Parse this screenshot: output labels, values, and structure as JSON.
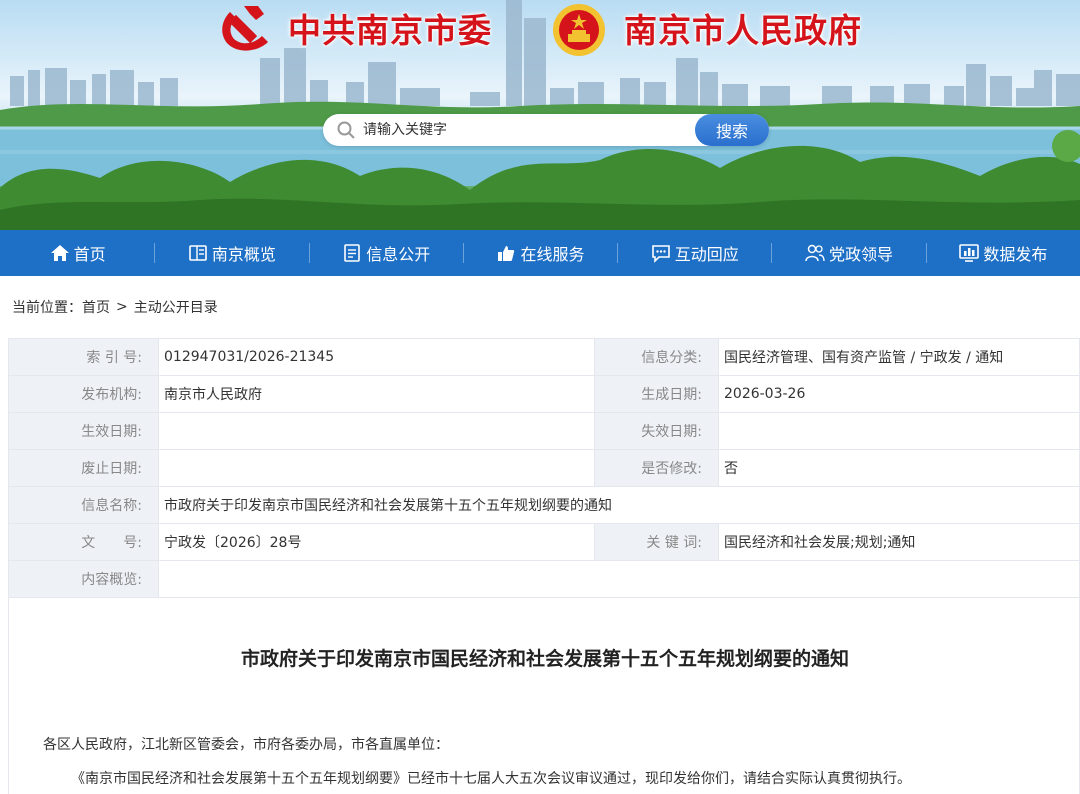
{
  "header": {
    "brand_left": "中共南京市委",
    "brand_right": "南京市人民政府",
    "party_emblem_icon": "party-emblem-icon",
    "national_emblem_icon": "national-emblem-icon",
    "accent_color": "#d4141a"
  },
  "search": {
    "placeholder": "请输入关键字",
    "button_label": "搜索"
  },
  "nav": {
    "items": [
      {
        "label": "首页",
        "icon": "home-icon"
      },
      {
        "label": "南京概览",
        "icon": "overview-icon"
      },
      {
        "label": "信息公开",
        "icon": "document-icon"
      },
      {
        "label": "在线服务",
        "icon": "thumbs-up-icon"
      },
      {
        "label": "互动回应",
        "icon": "chat-icon"
      },
      {
        "label": "党政领导",
        "icon": "people-icon"
      },
      {
        "label": "数据发布",
        "icon": "chart-icon"
      }
    ],
    "bg_color": "#1e6fc6"
  },
  "breadcrumb": {
    "prefix": "当前位置：",
    "home": "首页",
    "separator": ">",
    "current": "主动公开目录"
  },
  "info": {
    "index_label": "索 引 号:",
    "index_value": "012947031/2026-21345",
    "category_label": "信息分类:",
    "category_value": "国民经济管理、国有资产监管 / 宁政发 / 通知",
    "publisher_label": "发布机构:",
    "publisher_value": "南京市人民政府",
    "created_label": "生成日期:",
    "created_value": "2026-03-26",
    "effective_label": "生效日期:",
    "effective_value": "",
    "expiry_label": "失效日期:",
    "expiry_value": "",
    "repeal_label": "废止日期:",
    "repeal_value": "",
    "modified_label": "是否修改:",
    "modified_value": "否",
    "name_label": "信息名称:",
    "name_value": "市政府关于印发南京市国民经济和社会发展第十五个五年规划纲要的通知",
    "docno_label": "文　　号:",
    "docno_value": "宁政发〔2026〕28号",
    "keywords_label": "关 键 词:",
    "keywords_value": "国民经济和社会发展;规划;通知",
    "summary_label": "内容概览:",
    "summary_value": ""
  },
  "article": {
    "title": "市政府关于印发南京市国民经济和社会发展第十五个五年规划纲要的通知",
    "p1": "各区人民政府，江北新区管委会，市府各委办局，市各直属单位：",
    "p2": "《南京市国民经济和社会发展第十五个五年规划纲要》已经市十七届人大五次会议审议通过，现印发给你们，请结合实际认真贯彻执行。"
  }
}
